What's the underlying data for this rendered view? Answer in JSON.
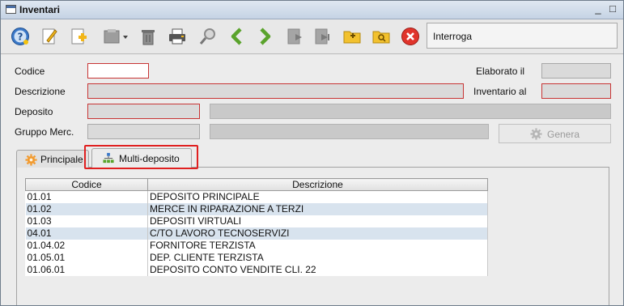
{
  "window": {
    "title": "Inventari",
    "minimize": "_",
    "maximize": "□"
  },
  "toolbar": {
    "buttons": [
      {
        "icon": "help-icon"
      },
      {
        "icon": "edit-icon"
      },
      {
        "icon": "new-document-icon"
      },
      {
        "icon": "template-dropdown-icon"
      },
      {
        "icon": "trash-icon"
      },
      {
        "icon": "printer-icon"
      },
      {
        "icon": "search-magnifier-icon"
      },
      {
        "icon": "arrow-left-icon"
      },
      {
        "icon": "arrow-right-icon"
      },
      {
        "icon": "export-icon"
      },
      {
        "icon": "export-next-icon"
      },
      {
        "icon": "folder-add-icon"
      },
      {
        "icon": "folder-search-icon"
      },
      {
        "icon": "close-red-icon"
      }
    ],
    "command_label": "Interroga"
  },
  "form": {
    "codice_label": "Codice",
    "descrizione_label": "Descrizione",
    "deposito_label": "Deposito",
    "gruppo_label": "Gruppo Merc.",
    "elaborato_label": "Elaborato il",
    "inventario_label": "Inventario al",
    "genera_label": "Genera"
  },
  "tabs": [
    {
      "label": "Principale",
      "icon": "gear-orange-icon"
    },
    {
      "label": "Multi-deposito",
      "icon": "hierarchy-icon"
    }
  ],
  "table": {
    "headers": [
      "Codice",
      "Descrizione"
    ],
    "rows": [
      [
        "01.01",
        "DEPOSITO PRINCIPALE"
      ],
      [
        "01.02",
        "MERCE IN RIPARAZIONE A TERZI"
      ],
      [
        "01.03",
        "DEPOSITI VIRTUALI"
      ],
      [
        "04.01",
        "C/TO LAVORO TECNOSERVIZI"
      ],
      [
        "01.04.02",
        "FORNITORE TERZISTA"
      ],
      [
        "01.05.01",
        "DEP. CLIENTE TERZISTA"
      ],
      [
        "01.06.01",
        "DEPOSITO CONTO VENDITE CLI. 22"
      ]
    ]
  },
  "colors": {
    "required_border": "#c73535",
    "highlight": "#e02020",
    "alt_row": "#d8e3ee"
  }
}
